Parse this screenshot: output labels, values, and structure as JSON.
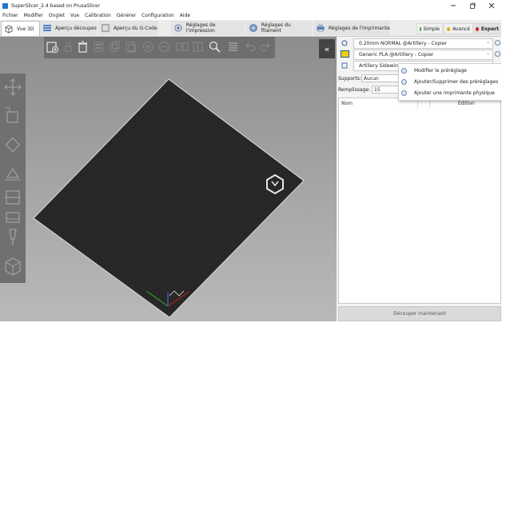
{
  "window": {
    "title": "SuperSlicer_2.4  based on PrusaSlicer",
    "controls": [
      "minimize",
      "maximize",
      "close"
    ]
  },
  "menubar": [
    "Fichier",
    "Modifier",
    "Onglet",
    "Vue",
    "Calibration",
    "Générer",
    "Configuration",
    "Aide"
  ],
  "tabs": [
    {
      "label": "Vue 3D",
      "icon": "cube-icon",
      "active": true
    },
    {
      "label": "Aperçu découpes",
      "icon": "layers-icon",
      "active": false
    },
    {
      "label": "Aperçu du G-Code",
      "icon": "gcode-icon",
      "active": false
    },
    {
      "label": "Réglages de l'impression",
      "icon": "gear-icon",
      "active": false
    },
    {
      "label": "Réglages du filament",
      "icon": "spool-icon",
      "active": false
    },
    {
      "label": "Réglages de l'imprimante",
      "icon": "printer-icon",
      "active": false
    }
  ],
  "modes": [
    {
      "label": "Simple",
      "color": "#33aa33"
    },
    {
      "label": "Avancé",
      "color": "#e0b000"
    },
    {
      "label": "Expert",
      "color": "#cc2222",
      "active": true
    }
  ],
  "colors": {
    "accent_blue": "#1e78c8",
    "filament_swatch": "#f0d000",
    "bed": "#262626",
    "viewport_top": "#8d8d8d",
    "viewport_bottom": "#b9b9b9"
  },
  "sidebar": {
    "print_preset": "0.20mm NORMAL @Artillery - Copier",
    "filament_preset": "Generic PLA @Artillery - Copier",
    "printer_preset": "Artillery Sidewinder",
    "supports_label": "Supports:",
    "supports_value": "Aucun",
    "infill_label": "Remplissage:",
    "infill_value": "15",
    "object_list": {
      "col_name": "Nom",
      "col_edit": "Édition"
    },
    "slice_button": "Découper maintenant"
  },
  "printer_menu": [
    "Modifier le préréglage",
    "Ajouter/Supprimer des préréglages",
    "Ajouter une imprimante physique"
  ],
  "collapse_glyph": "«"
}
